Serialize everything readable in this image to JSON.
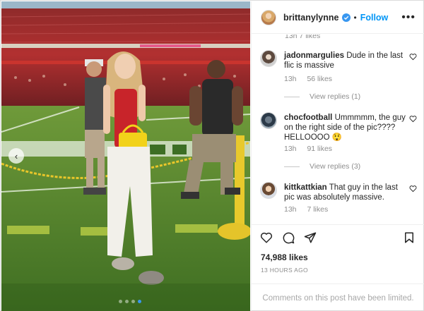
{
  "post": {
    "username": "brittanylynne",
    "separator": "•",
    "follow_label": "Follow",
    "more_label": "•••"
  },
  "comments_list": {
    "partial_meta": "13h  7 likes",
    "items": [
      {
        "username": "jadonmargulies",
        "text": "Dude in the last flic is massive",
        "age": "13h",
        "likes": "56 likes",
        "replies_label": "View replies (1)"
      },
      {
        "username": "chocfootball",
        "text": "Ummmmm, the guy on the right side of the pic???? HELLOOOO 😲",
        "age": "13h",
        "likes": "91 likes",
        "replies_label": "View replies (3)"
      },
      {
        "username": "kittkattkian",
        "text": "That guy in the last pic was absolutely massive.",
        "age": "13h",
        "likes": "7 likes"
      }
    ]
  },
  "actions": {
    "likes_count": "74,988 likes",
    "timestamp": "13 HOURS AGO",
    "comments_limited": "Comments on this post have been limited."
  },
  "carousel": {
    "prev_label": "‹"
  },
  "icons": {
    "heart": "heart-icon",
    "comment": "comment-icon",
    "share": "share-icon",
    "save": "bookmark-icon",
    "verified": "verified-badge-icon"
  },
  "colors": {
    "accent": "#0095f6",
    "secondary_text": "#8e8e8e",
    "primary_text": "#262626"
  }
}
